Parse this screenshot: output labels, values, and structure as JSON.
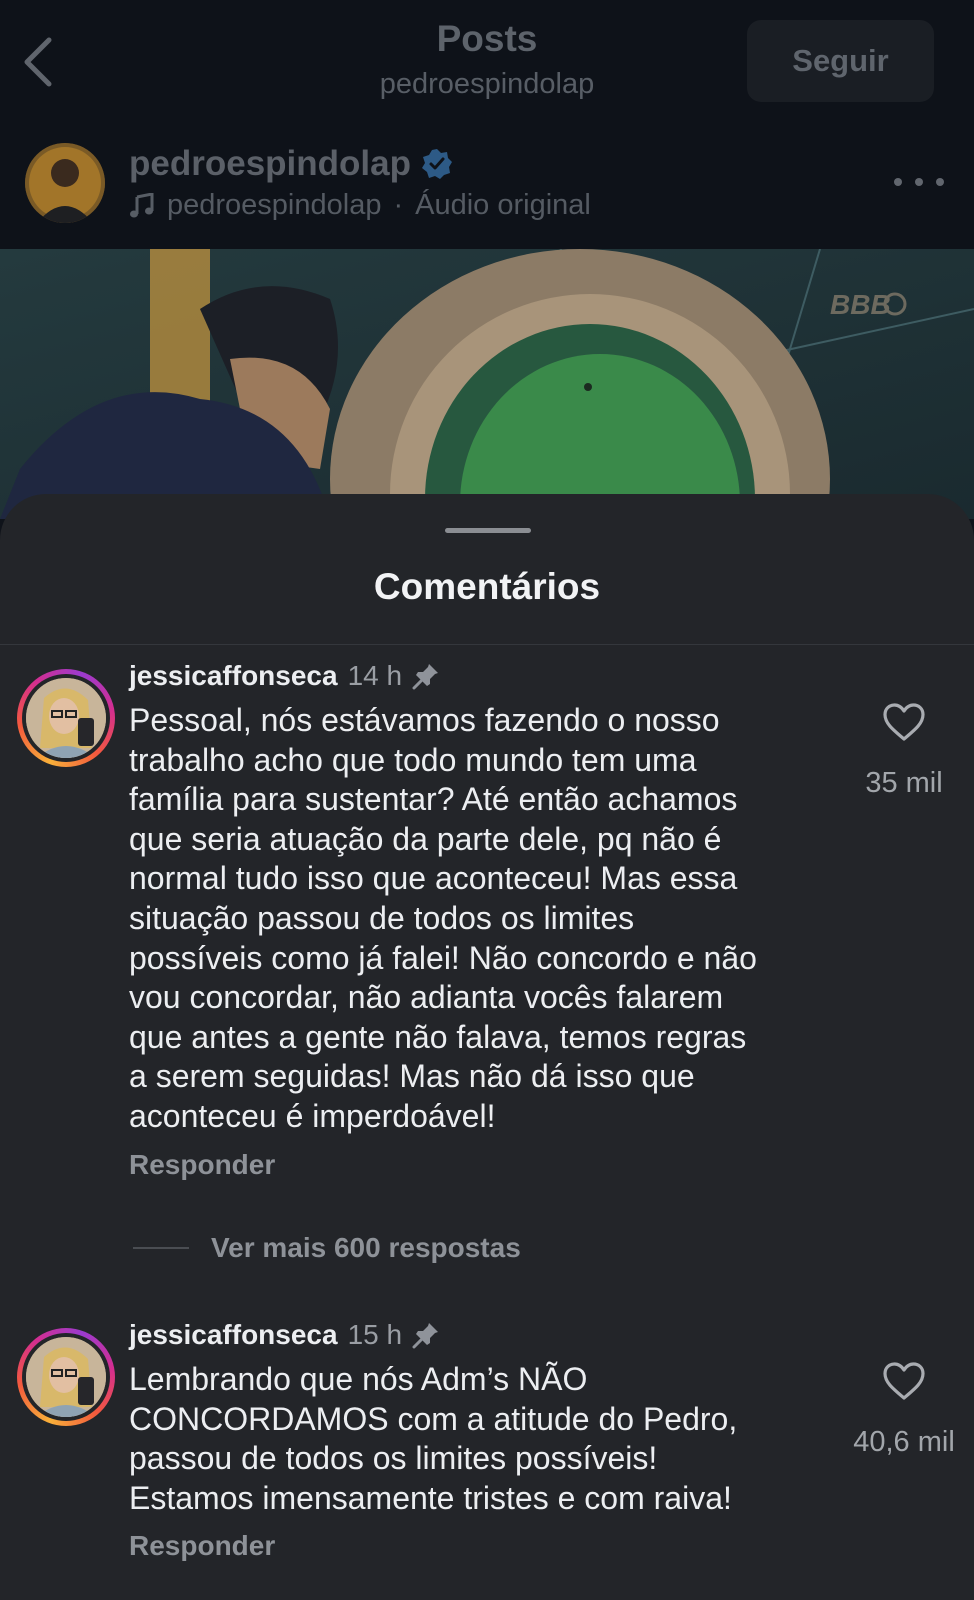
{
  "header": {
    "title": "Posts",
    "subtitle": "pedroespindolap",
    "follow_label": "Seguir"
  },
  "post": {
    "username": "pedroespindolap",
    "audio_user": "pedroespindolap",
    "audio_separator": "·",
    "audio_label": "Áudio original",
    "media_badge": "BBB"
  },
  "comments_sheet": {
    "title": "Comentários",
    "comments": [
      {
        "username": "jessicaffonseca",
        "time": "14 h",
        "text": "Pessoal, nós estávamos fazendo o nosso\ntrabalho acho que todo mundo tem uma\nfamília para sustentar? Até então achamos\nque seria atuação da parte dele, pq não é\nnormal tudo isso que aconteceu! Mas essa\nsituação passou de todos os limites\npossíveis como já falei! Não concordo e não\nvou concordar, não adianta vocês falarem\nque antes a gente não falava, temos regras\na serem seguidas! Mas não dá isso que\naconteceu é imperdoável!",
        "likes": "35 mil",
        "reply_label": "Responder",
        "more_replies": "Ver mais 600 respostas"
      },
      {
        "username": "jessicaffonseca",
        "time": "15 h",
        "text": "Lembrando que nós Adm’s NÃO\nCONCORDAMOS com a atitude do Pedro,\npassou de todos os limites possíveis!\nEstamos imensamente tristes e com raiva!",
        "likes": "40,6 mil",
        "reply_label": "Responder"
      }
    ]
  },
  "icons": {
    "back": "chevron-left-icon",
    "verified": "verified-badge-icon",
    "music": "music-note-icon",
    "more": "more-horizontal-icon",
    "pin": "pin-icon",
    "like": "heart-outline-icon"
  },
  "colors": {
    "sheet_background": "#232529",
    "verified_blue": "#3897f0",
    "story_ring_start": "#f8b03a",
    "story_ring_end": "#9b3bcf"
  }
}
